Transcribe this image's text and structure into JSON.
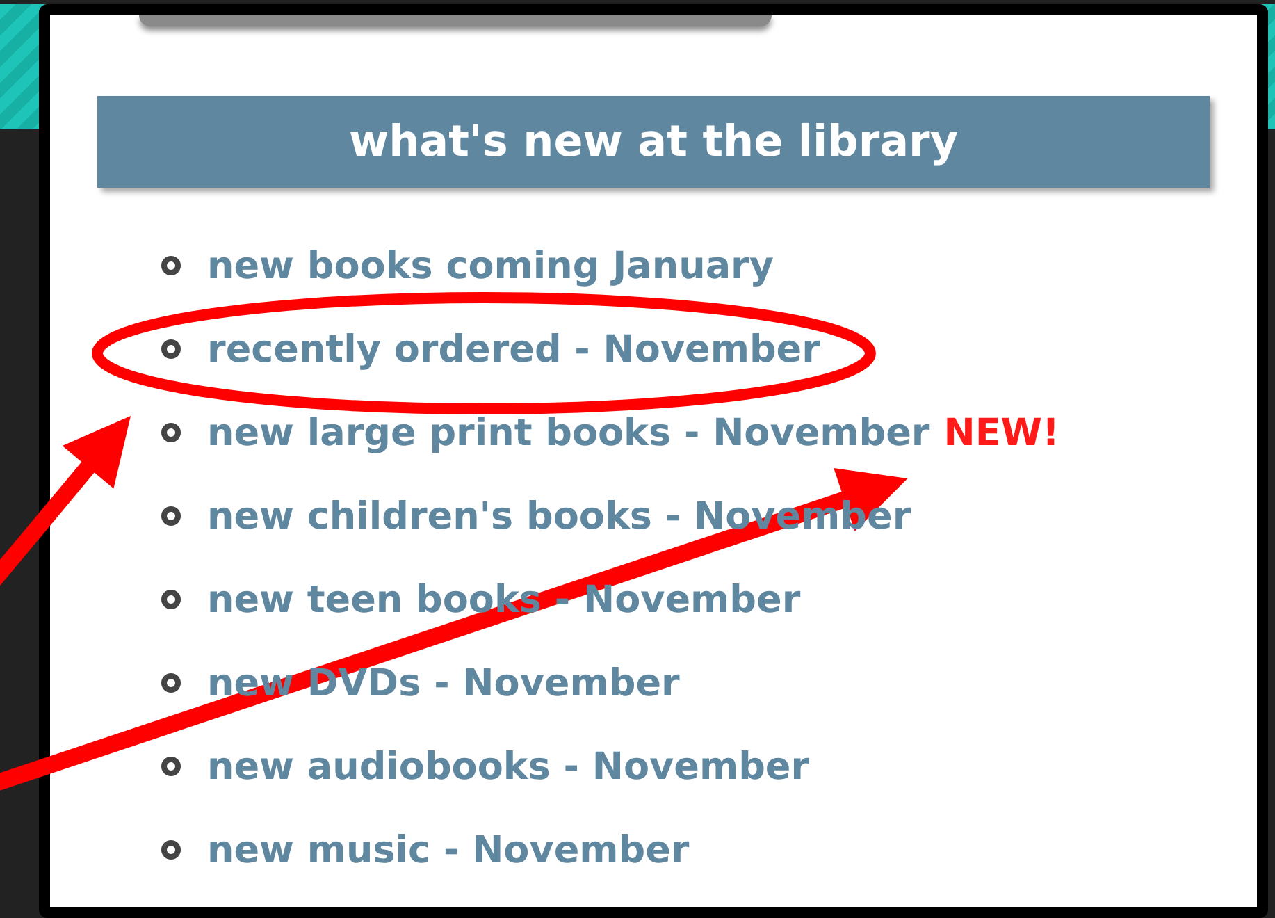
{
  "heading": "what's new at the library",
  "items": [
    {
      "text": "new books coming January"
    },
    {
      "text": "recently ordered - November",
      "circled": true
    },
    {
      "text": "new large print books - November",
      "badge": "NEW!"
    },
    {
      "text": "new children's books - November"
    },
    {
      "text": "new teen books - November"
    },
    {
      "text": "new DVDs - November"
    },
    {
      "text": "new audiobooks - November"
    },
    {
      "text": "new music - November"
    }
  ],
  "annotations": [
    {
      "kind": "arrow",
      "to_badge": false
    },
    {
      "kind": "arrow",
      "to_badge": true
    }
  ]
}
